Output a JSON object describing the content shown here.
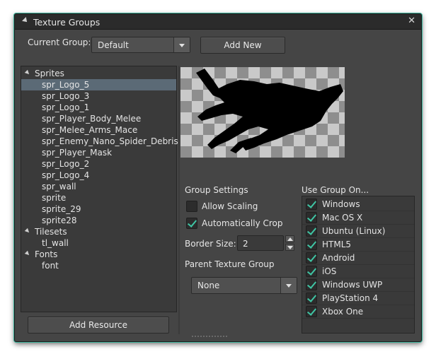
{
  "window": {
    "title": "Texture Groups",
    "close_glyph": "✕"
  },
  "current_group": {
    "label": "Current Group:",
    "value": "Default"
  },
  "add_new_label": "Add New",
  "tree": {
    "groups": [
      {
        "label": "Sprites",
        "items": [
          "spr_Logo_5",
          "spr_Logo_3",
          "spr_Logo_1",
          "spr_Player_Body_Melee",
          "spr_Melee_Arms_Mace",
          "spr_Enemy_Nano_Spider_Debris",
          "spr_Player_Mask",
          "spr_Logo_2",
          "spr_Logo_4",
          "spr_wall",
          "sprite",
          "sprite_29",
          "sprite28"
        ]
      },
      {
        "label": "Tilesets",
        "items": [
          "tl_wall"
        ]
      },
      {
        "label": "Fonts",
        "items": [
          "font"
        ]
      }
    ],
    "selected": "spr_Logo_5"
  },
  "add_resource_label": "Add Resource",
  "group_settings": {
    "heading": "Group Settings",
    "allow_scaling": {
      "label": "Allow Scaling",
      "checked": false
    },
    "automatically_crop": {
      "label": "Automatically Crop",
      "checked": true
    },
    "border_size": {
      "label": "Border Size:",
      "value": "2"
    },
    "parent_group": {
      "label": "Parent Texture Group",
      "value": "None"
    }
  },
  "use_group_on": {
    "heading": "Use Group On...",
    "platforms": [
      {
        "label": "Windows",
        "checked": true
      },
      {
        "label": "Mac OS X",
        "checked": true
      },
      {
        "label": "Ubuntu (Linux)",
        "checked": true
      },
      {
        "label": "HTML5",
        "checked": true
      },
      {
        "label": "Android",
        "checked": true
      },
      {
        "label": "iOS",
        "checked": true
      },
      {
        "label": "Windows UWP",
        "checked": true
      },
      {
        "label": "PlayStation 4",
        "checked": true
      },
      {
        "label": "Xbox One",
        "checked": true
      }
    ]
  },
  "colors": {
    "accent": "#3bb29a",
    "check": "#3fc5a4",
    "selection": "#5b6a76",
    "panel": "#454545"
  }
}
